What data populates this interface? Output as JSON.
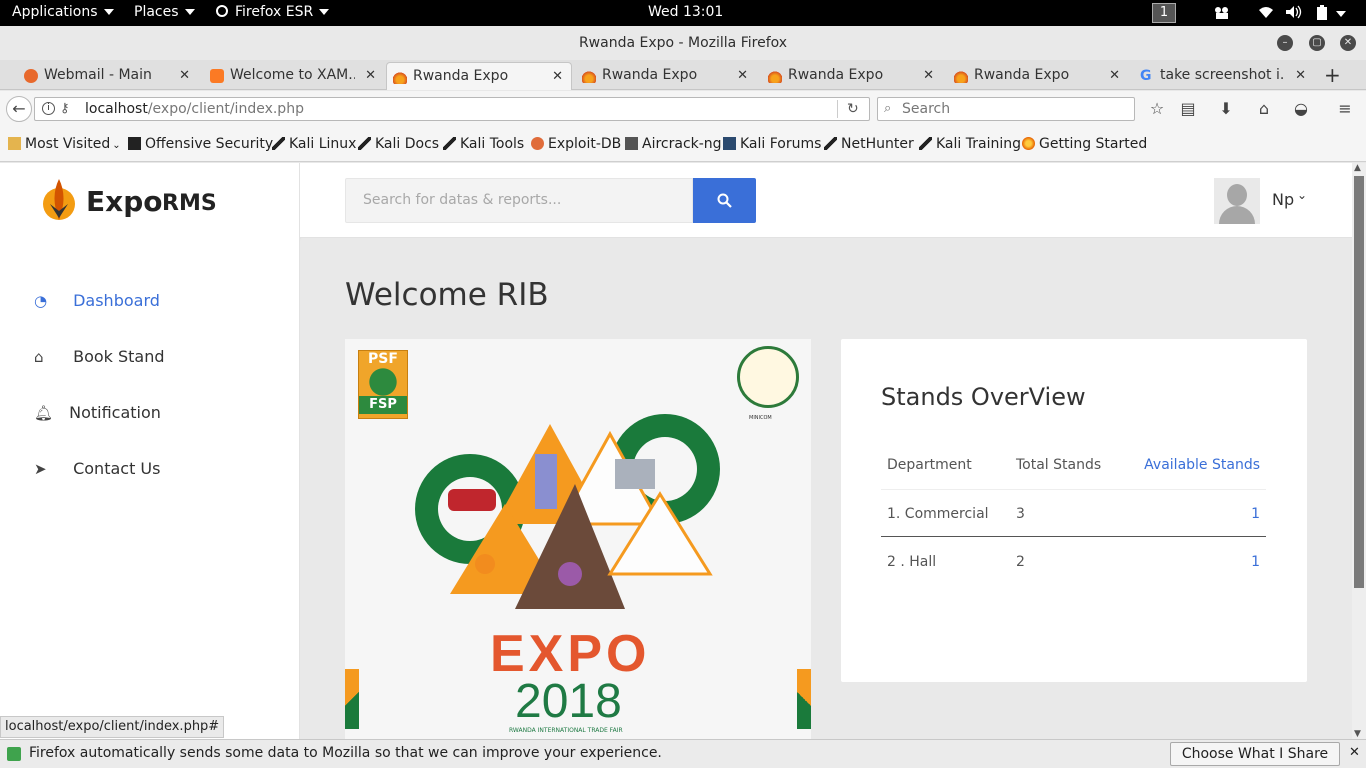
{
  "system_bar": {
    "applications": "Applications",
    "places": "Places",
    "firefox": "Firefox ESR",
    "clock": "Wed 13:01",
    "workspace": "1"
  },
  "window": {
    "title": "Rwanda Expo - Mozilla Firefox"
  },
  "tabs": [
    {
      "label": "Webmail - Main",
      "icon": "cpanel-icon"
    },
    {
      "label": "Welcome to XAM...",
      "icon": "xampp-icon"
    },
    {
      "label": "Rwanda Expo",
      "icon": "flame-icon",
      "active": true
    },
    {
      "label": "Rwanda Expo",
      "icon": "flame-icon"
    },
    {
      "label": "Rwanda Expo",
      "icon": "flame-icon"
    },
    {
      "label": "Rwanda Expo",
      "icon": "flame-icon"
    },
    {
      "label": "take screenshot i...",
      "icon": "google-icon"
    }
  ],
  "nav": {
    "url_host": "localhost",
    "url_path": "/expo/client/index.php",
    "search_placeholder": "Search"
  },
  "bookmarks": [
    "Most Visited",
    "Offensive Security",
    "Kali Linux",
    "Kali Docs",
    "Kali Tools",
    "Exploit-DB",
    "Aircrack-ng",
    "Kali Forums",
    "NetHunter",
    "Kali Training",
    "Getting Started"
  ],
  "app": {
    "brand_main": "Expo",
    "brand_sub": "RMS",
    "search_placeholder": "Search for datas & reports...",
    "user_name": "Np",
    "menu": [
      {
        "label": "Dashboard",
        "icon": "dashboard-icon",
        "active": true
      },
      {
        "label": "Book Stand",
        "icon": "home-icon"
      },
      {
        "label": "Notification",
        "icon": "bell-icon"
      },
      {
        "label": "Contact Us",
        "icon": "paper-plane-icon"
      }
    ],
    "welcome": "Welcome RIB",
    "poster": {
      "psf": "PSF",
      "fsp": "FSP",
      "expo": "EXPO",
      "year": "2018",
      "caption": "RWANDA INTERNATIONAL TRADE FAIR",
      "seal": "MINICOM"
    },
    "overview": {
      "title": "Stands OverView",
      "headers": [
        "Department",
        "Total Stands",
        "Available Stands"
      ],
      "rows": [
        {
          "dept": "1. Commercial",
          "total": "3",
          "available": "1"
        },
        {
          "dept": "2 . Hall",
          "total": "2",
          "available": "1"
        }
      ]
    },
    "accent": "#3a6fd8"
  },
  "status_url": "localhost/expo/client/index.php#",
  "notification": {
    "text": "Firefox automatically sends some data to Mozilla so that we can improve your experience.",
    "button": "Choose What I Share"
  }
}
